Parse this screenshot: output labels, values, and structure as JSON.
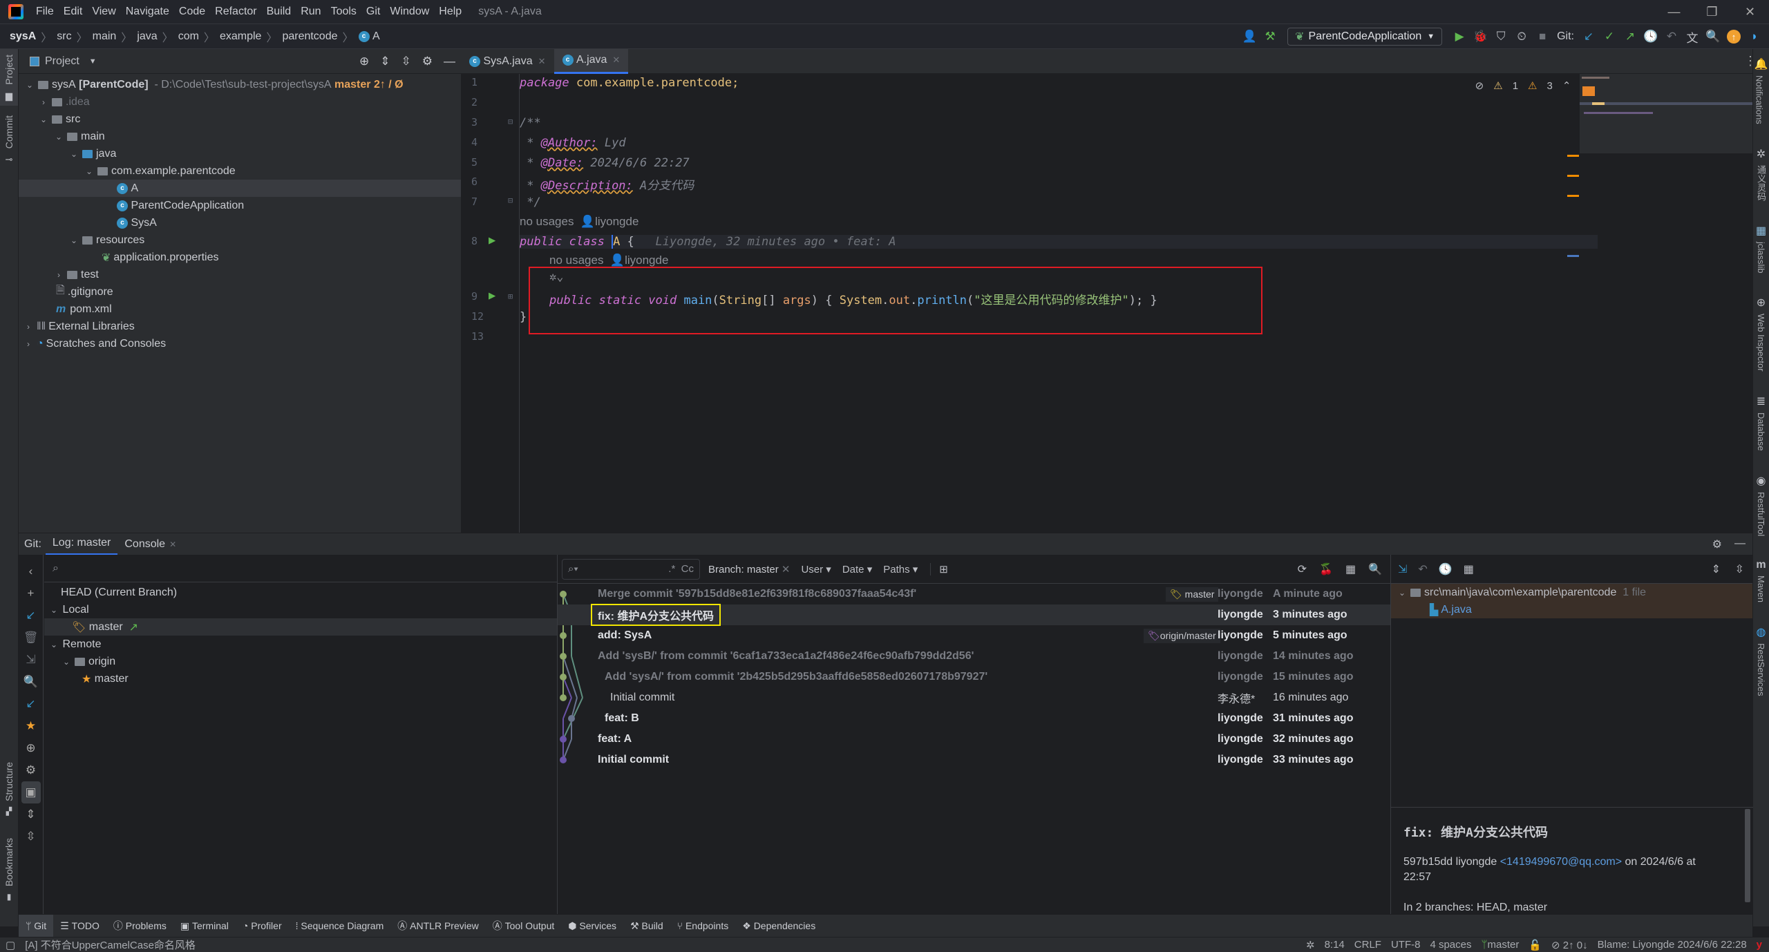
{
  "title_bar": {
    "menu": [
      "File",
      "Edit",
      "View",
      "Navigate",
      "Code",
      "Refactor",
      "Build",
      "Run",
      "Tools",
      "Git",
      "Window",
      "Help"
    ],
    "window_title": "sysA - A.java"
  },
  "breadcrumb": [
    "sysA",
    "src",
    "main",
    "java",
    "com",
    "example",
    "parentcode",
    "A"
  ],
  "toolbar": {
    "run_config": "ParentCodeApplication",
    "git_label": "Git:"
  },
  "left_stripe": {
    "project": "Project",
    "commit": "Commit",
    "structure": "Structure",
    "bookmarks": "Bookmarks"
  },
  "project_panel": {
    "title": "Project",
    "root_label": "sysA",
    "root_module": "[ParentCode]",
    "root_path": "- D:\\Code\\Test\\sub-test-project\\sysA",
    "root_branch": "master 2↑ / Ø",
    "items": [
      {
        "label": ".idea",
        "depth": 1,
        "type": "folder",
        "expanded": false
      },
      {
        "label": "src",
        "depth": 1,
        "type": "folder",
        "expanded": true
      },
      {
        "label": "main",
        "depth": 2,
        "type": "folder",
        "expanded": true
      },
      {
        "label": "java",
        "depth": 3,
        "type": "folder-blue",
        "expanded": true
      },
      {
        "label": "com.example.parentcode",
        "depth": 4,
        "type": "package",
        "expanded": true
      },
      {
        "label": "A",
        "depth": 5,
        "type": "class",
        "selected": true
      },
      {
        "label": "ParentCodeApplication",
        "depth": 5,
        "type": "class"
      },
      {
        "label": "SysA",
        "depth": 5,
        "type": "class"
      },
      {
        "label": "resources",
        "depth": 3,
        "type": "folder",
        "expanded": true
      },
      {
        "label": "application.properties",
        "depth": 4,
        "type": "properties"
      },
      {
        "label": "test",
        "depth": 2,
        "type": "folder",
        "expanded": false
      },
      {
        "label": ".gitignore",
        "depth": 1,
        "type": "file"
      },
      {
        "label": "pom.xml",
        "depth": 1,
        "type": "maven"
      },
      {
        "label": "External Libraries",
        "depth": 0,
        "type": "libs",
        "expanded": false
      },
      {
        "label": "Scratches and Consoles",
        "depth": 0,
        "type": "scratch",
        "expanded": false
      }
    ]
  },
  "editor": {
    "tabs": [
      {
        "label": "SysA.java",
        "active": false
      },
      {
        "label": "A.java",
        "active": true
      }
    ],
    "warnings": {
      "weak": "1",
      "strong": "3"
    },
    "lines": {
      "l1_num": "1",
      "l1_kw": "package",
      "l1_pkg": "com.example.parentcode;",
      "l2_num": "2",
      "l3_num": "3",
      "l3_text": "/**",
      "l4_num": "4",
      "l4_star": " * ",
      "l4_tag": "@Author:",
      "l4_val": " Lyd",
      "l5_num": "5",
      "l5_star": " * ",
      "l5_tag": "@Date:",
      "l5_val": " 2024/6/6 22:27",
      "l6_num": "6",
      "l6_star": " * ",
      "l6_tag": "@Description:",
      "l6_val": " A分支代码",
      "l7_num": "7",
      "l7_text": " */",
      "hint1_usages": "no usages",
      "hint1_author": "liyongde",
      "l8_num": "8",
      "l8_kw": "public class ",
      "l8_name": "A",
      "l8_brace": " {",
      "l8_blame": "Liyongde, 32 minutes ago • feat: A",
      "hint2_usages": "no usages",
      "hint2_author": "liyongde",
      "l9_num": "9",
      "l9_kw": "public static void ",
      "l9_fn": "main",
      "l9_p1": "(",
      "l9_ty": "String",
      "l9_p2": "[] ",
      "l9_arg": "args",
      "l9_p3": ") { ",
      "l9_sys": "System",
      "l9_dot1": ".",
      "l9_out": "out",
      "l9_dot2": ".",
      "l9_println": "println",
      "l9_p4": "(",
      "l9_str": "\"这里是公用代码的修改维护\"",
      "l9_p5": "); }",
      "l12_num": "12",
      "l12_text": "}",
      "l13_num": "13"
    }
  },
  "right_stripe": [
    "Notifications",
    "通义灵码",
    "jclasslib",
    "Web Inspector",
    "Database",
    "RestfulTool",
    "Maven",
    "RestServices"
  ],
  "git_panel": {
    "label": "Git:",
    "tabs": [
      {
        "label": "Log: master",
        "active": true
      },
      {
        "label": "Console",
        "active": false
      }
    ],
    "branches": {
      "head": "HEAD (Current Branch)",
      "local": "Local",
      "local_master": "master",
      "remote": "Remote",
      "origin": "origin",
      "remote_master": "master"
    },
    "filters": {
      "search_placeholder": "",
      "regex": ".*",
      "case": "Cc",
      "branch": "Branch: master",
      "user": "User",
      "date": "Date",
      "paths": "Paths"
    },
    "commits": [
      {
        "message": "Merge commit '597b15dd8e81e2f639f81f8c689037faaa54c43f'",
        "author": "liyongde",
        "date": "A minute ago",
        "style": "dim",
        "ref": "master"
      },
      {
        "message": "fix: 维护A分支公共代码",
        "author": "liyongde",
        "date": "3 minutes ago",
        "style": "bold",
        "selected": true
      },
      {
        "message": "add: SysA",
        "author": "liyongde",
        "date": "5 minutes ago",
        "style": "bold",
        "ref": "origin/master"
      },
      {
        "message": "Add 'sysB/' from commit '6caf1a733eca1a2f486e24f6ec90afb799dd2d56'",
        "author": "liyongde",
        "date": "14 minutes ago",
        "style": "dim"
      },
      {
        "message": "Add 'sysA/' from commit '2b425b5d295b3aaffd6e5858ed02607178b97927'",
        "author": "liyongde",
        "date": "15 minutes ago",
        "style": "dim"
      },
      {
        "message": "Initial commit",
        "author": "李永德*",
        "date": "16 minutes ago",
        "style": "normal"
      },
      {
        "message": "feat: B",
        "author": "liyongde",
        "date": "31 minutes ago",
        "style": "bold"
      },
      {
        "message": "feat: A",
        "author": "liyongde",
        "date": "32 minutes ago",
        "style": "bold"
      },
      {
        "message": "Initial commit",
        "author": "liyongde",
        "date": "33 minutes ago",
        "style": "bold"
      }
    ],
    "changes": {
      "folder": "src\\main\\java\\com\\example\\parentcode",
      "count": "1 file",
      "file": "A.java"
    },
    "details": {
      "title": "fix: 维护A分支公共代码",
      "hash_author": "597b15dd liyongde",
      "email": "<1419499670@qq.com>",
      "date_prefix": "on 2024/6/6 at",
      "time": "22:57",
      "branches": "In 2 branches: HEAD, master"
    }
  },
  "bottom_tools": [
    "Git",
    "TODO",
    "Problems",
    "Terminal",
    "Profiler",
    "Sequence Diagram",
    "ANTLR Preview",
    "Tool Output",
    "Services",
    "Build",
    "Endpoints",
    "Dependencies"
  ],
  "status_bar": {
    "message": "[A] 不符合UpperCamelCase命名风格",
    "position": "8:14",
    "line_sep": "CRLF",
    "encoding": "UTF-8",
    "indent": "4 spaces",
    "branch": "master",
    "sync": "2↑ 0↓",
    "blame": "Blame: Liyongde 2024/6/6 22:28"
  },
  "colors": {
    "accent": "#3574f0",
    "highlight_box": "#e01b24",
    "selected_commit_box": "#f2e600",
    "graph_green": "#8fa86a",
    "graph_teal": "#5f8f7f",
    "graph_purple": "#6a53a8",
    "graph_slate": "#6a7590"
  }
}
